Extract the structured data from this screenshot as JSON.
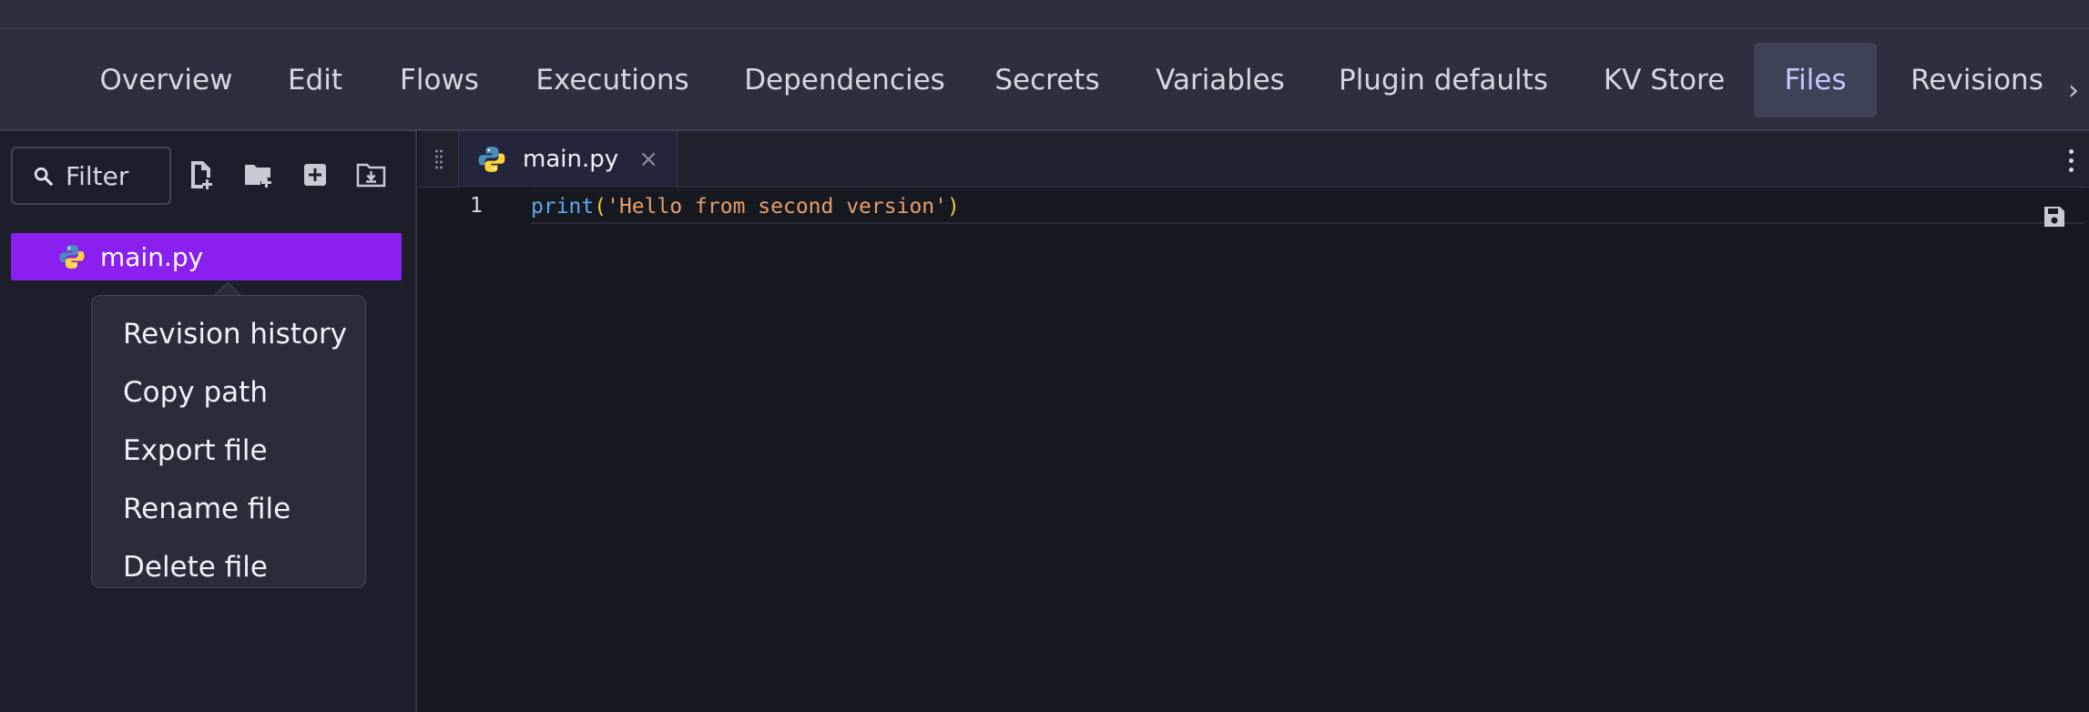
{
  "tabs": [
    {
      "label": "Overview",
      "active": false
    },
    {
      "label": "Edit",
      "active": false
    },
    {
      "label": "Flows",
      "active": false
    },
    {
      "label": "Executions",
      "active": false
    },
    {
      "label": "Dependencies",
      "active": false
    },
    {
      "label": "Secrets",
      "active": false
    },
    {
      "label": "Variables",
      "active": false
    },
    {
      "label": "Plugin defaults",
      "active": false
    },
    {
      "label": "KV Store",
      "active": false
    },
    {
      "label": "Files",
      "active": true
    },
    {
      "label": "Revisions",
      "active": false
    }
  ],
  "sidebar": {
    "filter_label": "Filter",
    "tools": [
      "new-file-icon",
      "new-folder-icon",
      "add-icon",
      "import-folder-icon"
    ],
    "files": [
      {
        "name": "main.py",
        "icon": "python-icon",
        "selected": true
      }
    ]
  },
  "context_menu": {
    "items": [
      "Revision history",
      "Copy path",
      "Export file",
      "Rename file",
      "Delete file"
    ]
  },
  "editor": {
    "tab_name": "main.py",
    "line_number": "1",
    "code": {
      "fn": "print",
      "open": "(",
      "str": "'Hello from second version'",
      "close": ")"
    }
  },
  "colors": {
    "accent": "#8a1ff0",
    "active_tab": "#c5c8ff",
    "background": "#161920"
  }
}
